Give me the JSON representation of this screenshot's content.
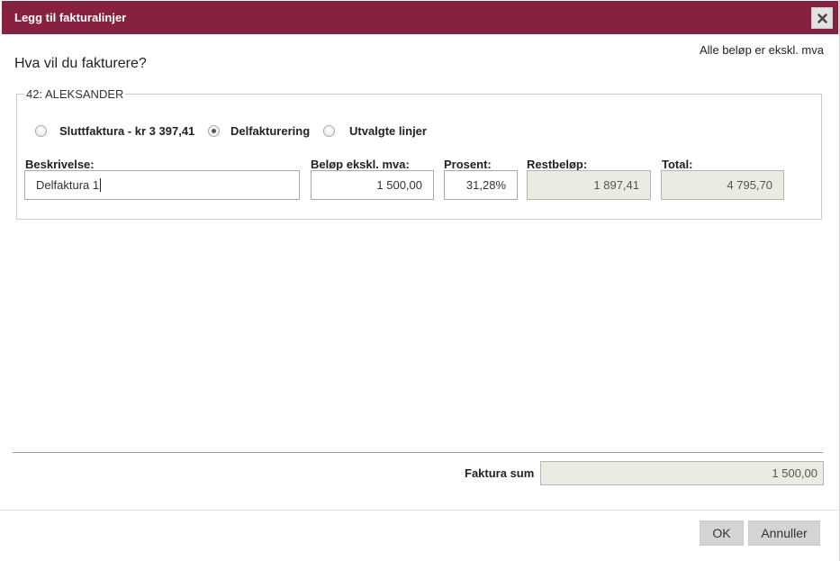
{
  "dialog": {
    "title": "Legg til fakturalinjer",
    "note": "Alle beløp er ekskl. mva",
    "question": "Hva vil du fakturere?"
  },
  "group": {
    "legend": "42: ALEKSANDER",
    "options": [
      {
        "label": "Sluttfaktura - kr 3 397,41",
        "checked": false
      },
      {
        "label": "Delfakturering",
        "checked": true
      },
      {
        "label": "Utvalgte linjer",
        "checked": false
      }
    ]
  },
  "fields": {
    "beskrivelse": {
      "label": "Beskrivelse:",
      "value": "Delfaktura 1"
    },
    "belop": {
      "label": "Beløp ekskl. mva:",
      "value": "1 500,00"
    },
    "prosent": {
      "label": "Prosent:",
      "value": "31,28%"
    },
    "restbelop": {
      "label": "Restbeløp:",
      "value": "1 897,41"
    },
    "total": {
      "label": "Total:",
      "value": "4 795,70"
    }
  },
  "summary": {
    "label": "Faktura sum",
    "value": "1 500,00"
  },
  "buttons": {
    "ok": "OK",
    "cancel": "Annuller"
  },
  "colors": {
    "titlebar": "#862140",
    "readonly_bg": "#ebebe4",
    "button_bg": "#d4d4d4"
  }
}
